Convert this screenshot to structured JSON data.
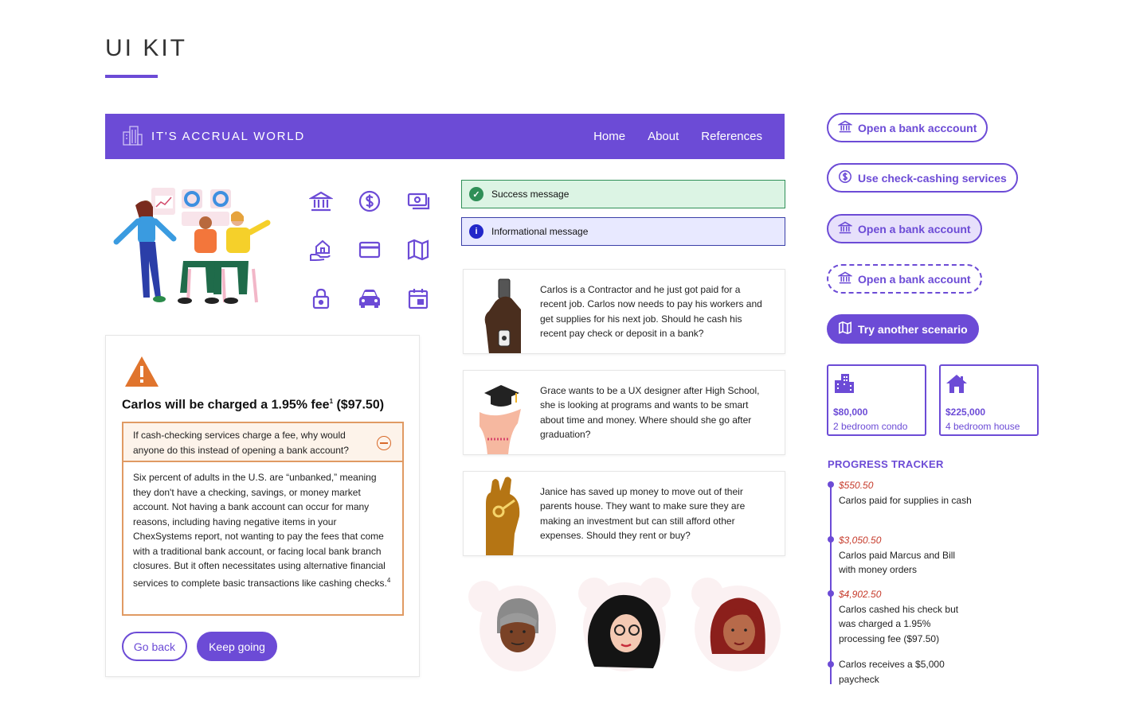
{
  "page": {
    "title": "UI KIT"
  },
  "colors": {
    "primary": "#6c4bd6",
    "success_bg": "#dcf4e4",
    "info_bg": "#e8e9ff",
    "warning": "#e0742d",
    "amount": "#c63a2a"
  },
  "nav": {
    "brand": "IT'S ACCRUAL WORLD",
    "links": [
      "Home",
      "About",
      "References"
    ]
  },
  "icons": [
    "bank-icon",
    "dollar-coin-icon",
    "cash-icon",
    "house-hand-icon",
    "credit-card-icon",
    "map-icon",
    "lock-icon",
    "car-icon",
    "calendar-icon"
  ],
  "alerts": {
    "success": "Success message",
    "info": "Informational message"
  },
  "scenarios": [
    {
      "text": "Carlos is a Contractor and he just got paid for a recent job. Carlos now needs to pay his workers and get supplies for his next job. Should he cash his recent pay check or deposit in a bank?"
    },
    {
      "text": "Grace wants to be a UX designer after High School, she is looking at programs and wants to be smart about time and money. Where should she go after graduation?"
    },
    {
      "text": "Janice has saved up money to move out of their parents house. They want to make sure they are making an investment but can still afford other expenses. Should they rent or buy?"
    }
  ],
  "warning_card": {
    "title": "Carlos will be charged a 1.95% fee",
    "title_sup": "1",
    "title_amount": " ($97.50)",
    "question": "If cash-checking services charge a fee, why would anyone do this instead of opening a bank account?",
    "answer": "Six percent of adults in the U.S. are “unbanked,” meaning they don't have a checking, savings, or money market account. Not having a bank account can occur for many reasons, including having negative items in your ChexSystems report, not wanting to pay the fees that come with a traditional bank account, or facing local bank branch closures. But it often necessitates using alternative financial services to complete basic transactions like cashing checks.",
    "answer_sup": "4",
    "back_label": "Go back",
    "next_label": "Keep going"
  },
  "buttons": {
    "open_account_1": "Open a bank acccount",
    "check_cashing": "Use check-cashing services",
    "open_account_hover": "Open a bank account",
    "open_account_focus": "Open a bank account",
    "try_scenario": "Try another scenario"
  },
  "price_cards": [
    {
      "price": "$80,000",
      "desc": "2 bedroom condo",
      "icon": "apartment-building-icon"
    },
    {
      "price": "$225,000",
      "desc": "4 bedroom house",
      "icon": "house-icon"
    }
  ],
  "tracker": {
    "title": "PROGRESS TRACKER",
    "items": [
      {
        "amount": "$550.50",
        "text": "Carlos paid for supplies in cash"
      },
      {
        "amount": "$3,050.50",
        "text": "Carlos paid Marcus and Bill with money orders"
      },
      {
        "amount": "$4,902.50",
        "text": "Carlos cashed his check but was charged a 1.95% processing fee ($97.50)"
      },
      {
        "amount": "",
        "text": "Carlos receives a $5,000 paycheck"
      }
    ]
  }
}
